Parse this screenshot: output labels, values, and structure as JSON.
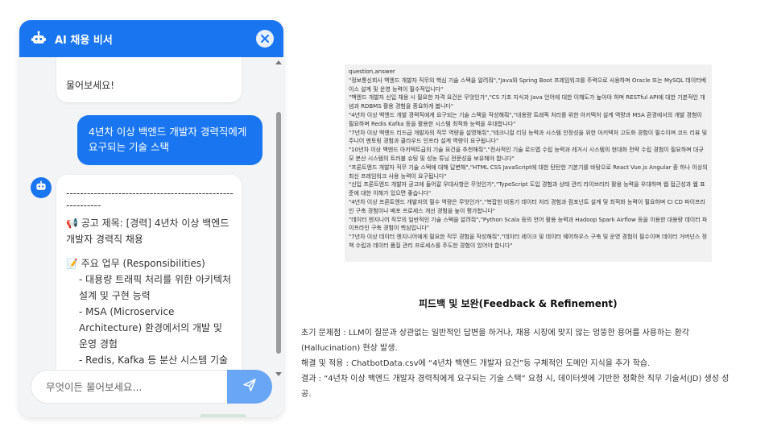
{
  "chat": {
    "title": "AI 채용 비서",
    "icons": {
      "bot": "robot-icon",
      "close": "close-icon",
      "send": "send-icon"
    },
    "colors": {
      "header": "#1976f0",
      "user_bubble": "#1976f0",
      "send_button": "#6aa6f6"
    },
    "previous_bot_message_tail": "물어보세요!",
    "user_message": "4년차 이상 백엔드 개발자 경력직에게 요구되는 기술 스택",
    "bot_message": {
      "divider": "----------------------------------------------------------",
      "title": "📢 공고 제목: [경력] 4년차 이상 백엔드 개발자 경력직 채용",
      "section": "📝 주요 업무 (Responsibilities)",
      "items": [
        "- 대용량 트래픽 처리를 위한 아키텍처 설계 및 구현 능력",
        "- MSA (Microservice Architecture) 환경에서의 개발 및 운영 경험",
        "- Redis, Kafka 등 분산 시스템 기술을 활용한 시스템 최적화 및 성능"
      ]
    },
    "input_placeholder": "무엇이든 물어보세요..."
  },
  "csv": {
    "lines": [
      "question,answer",
      "\"정보통신회사 백엔드 개발자 직무의 핵심 기술 스택을 알려줘\",\"Java와 Spring Boot 프레임워크를 주력으로 사용하며 Oracle 또는 MySQL 데이터베이스 설계 및 운영 능력이 필수적입니다\"",
      "\"백엔드 개발자 신입 채용 시 필요한 자격 요건은 무엇인가\",\"CS 기초 지식과 Java 언어에 대한 이해도가 높아야 하며 RESTful API에 대한 기본적인 개념과 RDBMS 활용 경험을 중요하게 봅니다\"",
      "\"4년차 이상 백엔드 개발 경력직에게 요구되는 기술 스택을 작성해줘\",\"대용량 트래픽 처리를 위한 아키텍처 설계 역량과 MSA 환경에서의 개발 경험이 필요하며 Redis Kafka 등을 활용한 시스템 최적화 능력을 우대합니다\"",
      "\"7년차 이상 백엔드 리드급 개발자의 직무 역량을 설명해줘\",\"테크니컬 리딩 능력과 시스템 안정성을 위한 아키텍처 고도화 경험이 필수이며 코드 리뷰 및 주니어 멘토링 경험과 클라우드 인프라 설계 역량이 요구됩니다\"",
      "\"10년차 이상 백엔드 아키텍트급의 기술 요건을 추천해줘\",\"전사적인 기술 로드맵 수립 능력과 레거시 시스템의 현대화 전략 수립 경험이 필요하며 대규모 분산 시스템의 트러블 슈팅 및 성능 튜닝 전문성을 보유해야 합니다\"",
      "\"프론트엔드 개발자 직무 기술 스택에 대해 답변해\",\"HTML CSS JavaScript에 대한 탄탄한 기본기를 바탕으로 React Vue.js Angular 중 하나 이상의 최신 프레임워크 사용 능력이 요구됩니다\"",
      "\"신입 프론트엔드 개발자 공고에 들어갈 우대사항은 무엇인가\",\"TypeScript 도입 경험과 상태 관리 라이브러리 활용 능력을 우대하며 웹 접근성과 웹 표준에 대한 이해가 있으면 좋습니다\"",
      "\"4년차 이상 프론트엔드 개발자의 필수 역량은 무엇인가\",\"복잡한 비동기 데이터 처리 경험과 컴포넌트 설계 및 최적화 능력이 필요하며 CI CD 파이프라인 구축 경험이나 배포 프로세스 개선 경험을 높이 평가합니다\"",
      "\"데이터 엔지니어 직무의 일반적인 기술 스택을 알려줘\",\"Python Scala 등의 언어 활용 능력과 Hadoop Spark Airflow 등을 이용한 대용량 데이터 파이프라인 구축 경험이 핵심입니다\"",
      "\"7년차 이상 데이터 엔지니어에게 필요한 직무 경험을 작성해줘\",\"데이터 레이크 및 데이터 웨어하우스 구축 및 운영 경험이 필수이며 데이터 거버넌스 정책 수립과 데이터 품질 관리 프로세스를 주도한 경험이 있어야 합니다\""
    ]
  },
  "section": {
    "title": "피드백 및 보완(Feedback & Refinement)",
    "lines": [
      "초기 문제점 : LLM이 질문과 상관없는 일반적인 답변을 하거나, 채용 시장에 맞지 않는 엉뚱한 용어를 사용하는 환각(Hallucination) 현상 발생.",
      "해결 및 적용 : ChatbotData.csv에 “4년차 백엔드 개발자 요건”등 구체적인 도메인 지식을 추가 학습.",
      "결과 : “4년차 이상 백엔드 개발자 경력직에게 요구되는 기술 스택” 요청 시, 데이터셋에 기반한 정확한 직무 기술서(JD) 생성 성공."
    ]
  }
}
